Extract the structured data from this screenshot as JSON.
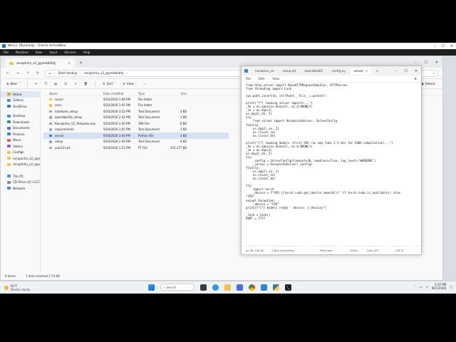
{
  "vbox": {
    "title": "Win11 [Running] - Oracle VirtualBox",
    "menu": [
      "File",
      "Machine",
      "View",
      "Input",
      "Devices",
      "Help"
    ]
  },
  "explorer": {
    "tab_label": "recaptcha_v2_@yeetdiddy",
    "breadcrumb": [
      "Start backup",
      "recaptcha_v2_@yeetdiddy"
    ],
    "search_placeholder": "Search recaptcha_v2_@yeetdiddy",
    "ribbon": [
      "New",
      "Sort",
      "View",
      "Details"
    ],
    "nav": [
      {
        "label": "Home",
        "color": "#e8a13a",
        "selected": true
      },
      {
        "label": "Gallery",
        "color": "#4a90d9"
      },
      {
        "label": "OneDrive",
        "color": "#2f7bd6"
      },
      {
        "label": "Desktop",
        "color": "#3b8fe6",
        "gap": true
      },
      {
        "label": "Downloads",
        "color": "#2a9d6b"
      },
      {
        "label": "Documents",
        "color": "#5b6fd6"
      },
      {
        "label": "Pictures",
        "color": "#2d86d8"
      },
      {
        "label": "Music",
        "color": "#e0624a"
      },
      {
        "label": "Videos",
        "color": "#8b5bd6"
      },
      {
        "label": "Configs",
        "color": "#f2c14e"
      },
      {
        "label": "recaptcha_v2_@yee",
        "color": "#f2c14e"
      },
      {
        "label": "recaptcha_v2_@yee",
        "color": "#f2c14e"
      },
      {
        "label": "This PC",
        "color": "#4a90d9",
        "gap2": true
      },
      {
        "label": "CD Drive (D:) CCCC",
        "color": "#888888"
      },
      {
        "label": "Network",
        "color": "#4a90d9"
      }
    ],
    "columns": {
      "name": "Name",
      "date": "Date modified",
      "type": "Type",
      "size": "Size"
    },
    "files": [
      {
        "name": "solver",
        "date": "9/20/2026 1:06 PM",
        "type": "File folder",
        "size": "",
        "color": "#f2c14e"
      },
      {
        "name": "venv",
        "date": "9/20/2026 1:01 PM",
        "type": "File folder",
        "size": "",
        "color": "#f2c14e"
      },
      {
        "name": "hardware_setup",
        "date": "9/20/2026 3:32 PM",
        "type": "Text Document",
        "size": "4 KB",
        "color": "#9aa4b2"
      },
      {
        "name": "opendball42_setup",
        "date": "9/20/2026 2:32 PM",
        "type": "Text Document",
        "size": "1 KB",
        "color": "#9aa4b2"
      },
      {
        "name": "Recaptcha_V2_Template.xpk",
        "date": "9/20/2026 2:40 PM",
        "type": "XPK File",
        "size": "6 KB",
        "color": "#9aa4b2"
      },
      {
        "name": "requirements",
        "date": "9/20/2026 1:05 PM",
        "type": "Text Document",
        "size": "1 KB",
        "color": "#9aa4b2"
      },
      {
        "name": "server",
        "date": "9/20/2026 3:40 PM",
        "type": "Python File",
        "size": "3 KB",
        "color": "#3f78c9",
        "selected": true
      },
      {
        "name": "setup",
        "date": "9/20/2026 2:46 PM",
        "type": "Text Document",
        "size": "4 KB",
        "color": "#9aa4b2"
      },
      {
        "name": "yolo12x.pt",
        "date": "9/20/2026 1:21 PM",
        "type": "PT File",
        "size": "115,177 KB",
        "color": "#9aa4b2"
      }
    ],
    "status": {
      "count": "9 items",
      "selection": "1 item selected  2.74 KB"
    }
  },
  "notepad": {
    "tabs": [
      {
        "label": "hardware_se"
      },
      {
        "label": "setup.txt"
      },
      {
        "label": "opendball42"
      },
      {
        "label": "config.py"
      },
      {
        "label": "server",
        "active": true
      }
    ],
    "menu": [
      "File",
      "Edit",
      "View"
    ],
    "code": [
      "from http.server import BaseHTTPRequestHandler, HTTPServer",
      "from threading import Lock",
      "",
      "sys.path.insert(0, str(Path(__file__).parent))",
      "",
      "print(\"[*] loading solver imports...\")",
      "_dn = os.open(os.devnull, os.O_WRONLY)",
      "_se = os.dup(2)",
      "os.dup2(_dn, 2)",
      "try:",
      "    from solver import RecaptchaSolver, SolverConfig",
      "finally:",
      "    os.dup2(_se, 2)",
      "    os.close(_se)",
      "    os.close(_dn)",
      "",
      "print(\"[*] loading models (first GPU run may take 2-5 min for CUDA compilation)...\")",
      "_dn = os.open(os.devnull, os.O_WRONLY)",
      "_se = os.dup(2)",
      "os.dup2(_dn, 2)",
      "try:",
      "    _config = SolverConfig(timeout=30, headless=True, log_level=\"WARNING\")",
      "    _solver = RecaptchaSolver(_config)",
      "finally:",
      "    os.dup2(_se, 2)",
      "    os.close(_se)",
      "    os.close(_dn)",
      "",
      "try:",
      "    import torch",
      "    _device = f\"GPU ({torch.cuda.get_device_name(0)})\" if torch.cuda.is_available() else",
      "\"CPU\"",
      "except Exception:",
      "    _device = \"CPU\"",
      "print(f\"[*] models ready - device: {_device}\")",
      "",
      "_lock = Lock()",
      "PORT = 7777"
    ],
    "status": {
      "position": "Ln 26, Col 30",
      "chars": "2,802 characters",
      "format": "Plain text",
      "zoom": "100%",
      "eol": "Unix (LF)",
      "encoding": "UTF-8"
    }
  },
  "taskbar": {
    "weather_temp": "61°F",
    "weather_desc": "Mostly cloudy",
    "search_placeholder": "Search",
    "time": "1:37 PM",
    "date": "9/21/2026"
  }
}
